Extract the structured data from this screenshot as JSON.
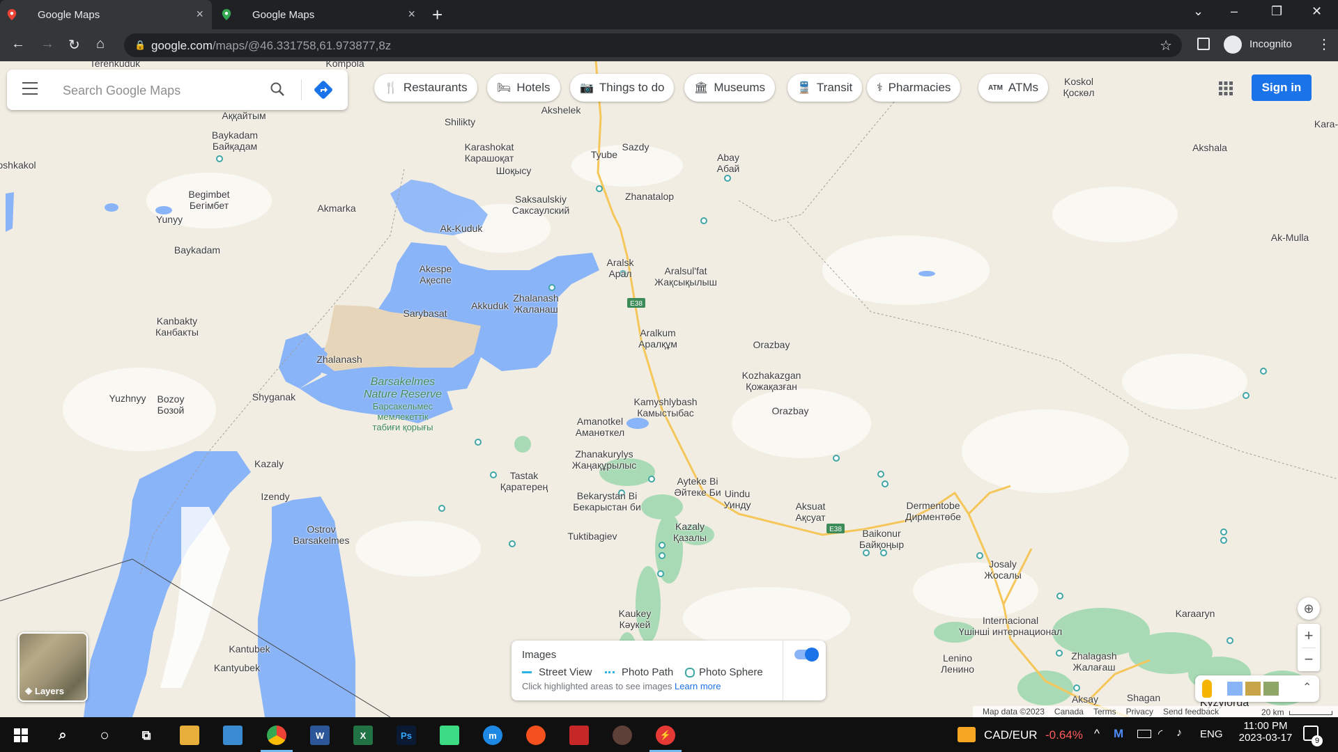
{
  "browser": {
    "tabs": [
      {
        "title": "Google Maps",
        "close": "×"
      },
      {
        "title": "Google Maps",
        "close": "×"
      }
    ],
    "new_tab": "+",
    "url_host": "google.com",
    "url_path": "/maps/@46.331758,61.973877,8z",
    "profile_label": "Incognito"
  },
  "search": {
    "placeholder": "Search Google Maps"
  },
  "chips": [
    {
      "label": "Restaurants",
      "icon": "restaurant-icon"
    },
    {
      "label": "Hotels",
      "icon": "hotel-icon"
    },
    {
      "label": "Things to do",
      "icon": "camera-icon"
    },
    {
      "label": "Museums",
      "icon": "museum-icon"
    },
    {
      "label": "Transit",
      "icon": "transit-icon"
    },
    {
      "label": "Pharmacies",
      "icon": "pharmacy-icon"
    },
    {
      "label": "ATMs",
      "icon": "atm-icon"
    }
  ],
  "signin_label": "Sign in",
  "layers_label": "Layers",
  "images_panel": {
    "title": "Images",
    "street_view": "Street View",
    "photo_path": "Photo Path",
    "photo_sphere": "Photo Sphere",
    "hint": "Click highlighted areas to see images",
    "learn_more": "Learn more",
    "toggle_on": true
  },
  "places": [
    {
      "name": "Terenkuduk",
      "name2": ""
    },
    {
      "name": "Kompola",
      "name2": ""
    },
    {
      "name": "Аққайтым",
      "name2": ""
    },
    {
      "name": "Baykadam",
      "name2": "Байқадам"
    },
    {
      "name": "oshkakol",
      "name2": ""
    },
    {
      "name": "Begimbet",
      "name2": "Бегімбет"
    },
    {
      "name": "Yunyy",
      "name2": ""
    },
    {
      "name": "Akmarka",
      "name2": ""
    },
    {
      "name": "Baykadam",
      "name2": ""
    },
    {
      "name": "Kanbakty",
      "name2": "Канбакты"
    },
    {
      "name": "Yuzhnyy",
      "name2": ""
    },
    {
      "name": "Bozoy",
      "name2": "Бозой"
    },
    {
      "name": "Zhalanash",
      "name2": ""
    },
    {
      "name": "Shyganak",
      "name2": ""
    },
    {
      "name": "Kazaly",
      "name2": ""
    },
    {
      "name": "Izendy",
      "name2": ""
    },
    {
      "name": "Ostrov",
      "name2": "Barsakelmes"
    },
    {
      "name": "Kantubek",
      "name2": ""
    },
    {
      "name": "Kantyubek",
      "name2": ""
    },
    {
      "name": "Akshelek",
      "name2": ""
    },
    {
      "name": "Shilikty",
      "name2": ""
    },
    {
      "name": "Karashokat",
      "name2": "Карашоқат"
    },
    {
      "name": "Шоқысу",
      "name2": ""
    },
    {
      "name": "Tyube",
      "name2": ""
    },
    {
      "name": "Sazdy",
      "name2": ""
    },
    {
      "name": "Abay",
      "name2": "Абай"
    },
    {
      "name": "Saksaulskiy",
      "name2": "Саксаулский"
    },
    {
      "name": "Zhanatalop",
      "name2": ""
    },
    {
      "name": "Ak-Kuduk",
      "name2": ""
    },
    {
      "name": "Akespe",
      "name2": "Ақеспе"
    },
    {
      "name": "Aralsk",
      "name2": "Арал"
    },
    {
      "name": "Aralsul'fat",
      "name2": "Жақсықылыш"
    },
    {
      "name": "Akkuduk",
      "name2": ""
    },
    {
      "name": "Zhalanash",
      "name2": "Жаланаш"
    },
    {
      "name": "Sarybasat",
      "name2": ""
    },
    {
      "name": "Aralkum",
      "name2": "Аралқұм"
    },
    {
      "name": "Orazbay",
      "name2": ""
    },
    {
      "name": "Kozhakazgan",
      "name2": "Қожақазған"
    },
    {
      "name": "Orazbay",
      "name2": ""
    },
    {
      "name": "Kamyshlybash",
      "name2": "Камыстыбас"
    },
    {
      "name": "Amanotkel",
      "name2": "Аманөткел"
    },
    {
      "name": "Zhanakurylys",
      "name2": "Жаңақұрылыс"
    },
    {
      "name": "Tastak",
      "name2": "Қаратерең"
    },
    {
      "name": "Bekarystan Bi",
      "name2": "Бекарыстан би"
    },
    {
      "name": "Ayteke Bi",
      "name2": "Әйтеке Би"
    },
    {
      "name": "Uindu",
      "name2": "Уинду"
    },
    {
      "name": "Aksuat",
      "name2": "Ақсуат"
    },
    {
      "name": "Dermentobe",
      "name2": "Дирментөбе"
    },
    {
      "name": "Baikonur",
      "name2": "Байқоңыр"
    },
    {
      "name": "Tuktibagiev",
      "name2": ""
    },
    {
      "name": "Kazaly",
      "name2": "Қазалы"
    },
    {
      "name": "Kaukey",
      "name2": "Кәукей"
    },
    {
      "name": "Josaly",
      "name2": "Жосалы"
    },
    {
      "name": "Internacional",
      "name2": "Үшінші интернационал"
    },
    {
      "name": "Lenino",
      "name2": "Ленино"
    },
    {
      "name": "Zhalagash",
      "name2": "Жалағаш"
    },
    {
      "name": "Karaaryn",
      "name2": ""
    },
    {
      "name": "Aksay",
      "name2": ""
    },
    {
      "name": "Shagan",
      "name2": ""
    },
    {
      "name": "Kyzylorda",
      "name2": ""
    },
    {
      "name": "Koskol",
      "name2": "Қоскөл"
    },
    {
      "name": "Kara-",
      "name2": ""
    },
    {
      "name": "Akshala",
      "name2": ""
    },
    {
      "name": "Ak-Mulla",
      "name2": ""
    }
  ],
  "reserve": {
    "name": "Barsakelmes Nature Reserve",
    "name_kz": "Барсакельмес мемлекеттік табиғи қорығы"
  },
  "road_shields": [
    "E38",
    "E38"
  ],
  "footer": {
    "map_data": "Map data ©2023",
    "country": "Canada",
    "terms": "Terms",
    "privacy": "Privacy",
    "feedback": "Send feedback",
    "scale": "20 km"
  },
  "taskbar": {
    "ticker_label": "CAD/EUR",
    "ticker_change": "-0.64%",
    "language": "ENG",
    "time": "11:00 PM",
    "date": "2023-03-17",
    "notifications": "9"
  },
  "colors": {
    "water": "#8ab4f8",
    "land": "#f1ede3",
    "green": "#a8dab5",
    "reserve": "#e6d5b8",
    "road": "#f5c659",
    "accent": "#1a73e8"
  }
}
